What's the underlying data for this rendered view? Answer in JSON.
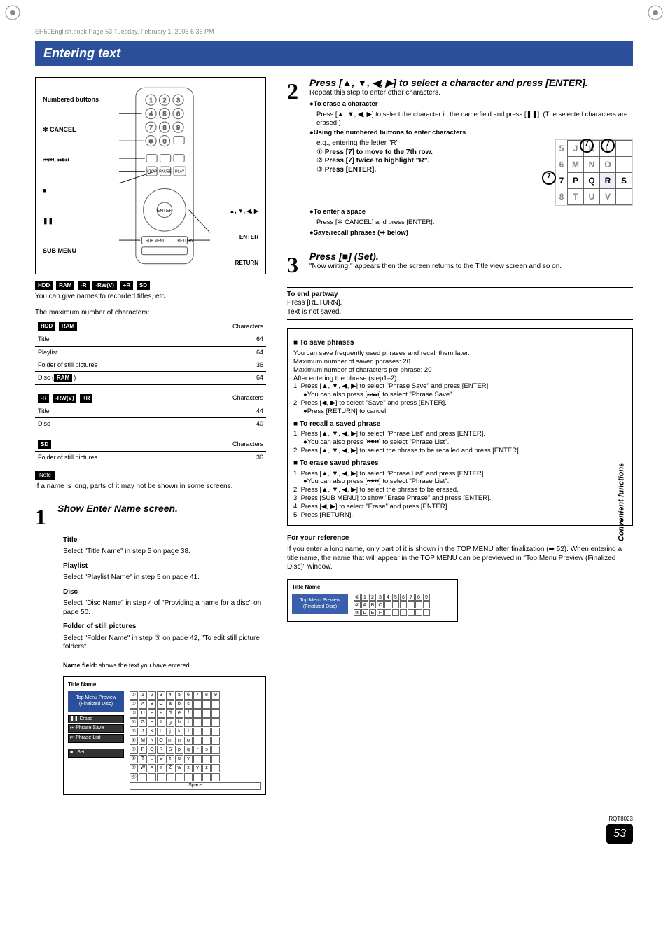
{
  "book_meta": "EH50English.book  Page 53  Tuesday, February 1, 2005  6:36 PM",
  "title": "Entering text",
  "remote": {
    "labels_left": [
      "Numbered buttons",
      "✻ CANCEL",
      "⏮⏮, ⏭⏭",
      "■",
      "❚❚",
      "SUB MENU"
    ],
    "labels_right": [
      "▲, ▼, ◀, ▶",
      "ENTER",
      "RETURN"
    ]
  },
  "formats1": [
    "HDD",
    "RAM",
    "-R",
    "-RW(V)",
    "+R",
    "SD"
  ],
  "intro1": "You can give names to recorded titles, etc.",
  "max_chars_head": "The maximum number of characters:",
  "table1_header_badges": [
    "HDD",
    "RAM"
  ],
  "table1_header_right": "Characters",
  "table1": [
    {
      "l": "Title",
      "r": "64"
    },
    {
      "l": "Playlist",
      "r": "64"
    },
    {
      "l": "Folder of still pictures",
      "r": "36"
    },
    {
      "l": "Disc (RAM)",
      "r": "64"
    }
  ],
  "table2_header_badges": [
    "-R",
    "-RW(V)",
    "+R"
  ],
  "table2_header_right": "Characters",
  "table2": [
    {
      "l": "Title",
      "r": "44"
    },
    {
      "l": "Disc",
      "r": "40"
    }
  ],
  "table3_header_badges": [
    "SD"
  ],
  "table3_header_right": "Characters",
  "table3": [
    {
      "l": "Folder of still pictures",
      "r": "36"
    }
  ],
  "note_label": "Note",
  "note_text": "If a name is long, parts of it may not be shown in some screens.",
  "step1_head": "Show Enter Name screen.",
  "step1_title_h": "Title",
  "step1_title_t": "Select \"Title Name\" in step 5 on page 38.",
  "step1_pl_h": "Playlist",
  "step1_pl_t": "Select \"Playlist Name\" in step 5 on page 41.",
  "step1_disc_h": "Disc",
  "step1_disc_t": "Select \"Disc Name\" in step 4 of \"Providing a name for a disc\" on page 50.",
  "step1_fold_h": "Folder of still pictures",
  "step1_fold_t": "Select \"Folder Name\" in step ③ on page 42, \"To edit still picture folders\".",
  "name_field_label": "Name field:",
  "name_field_text": "shows the text you have entered",
  "tn_title": "Title Name",
  "tn_preview_l1": "Top Menu Preview",
  "tn_preview_l2": "(Finalized Disc)",
  "tn_btn_erase": "Erase",
  "tn_btn_ps": "Phrase Save",
  "tn_btn_pl": "Phrase List",
  "tn_btn_set": "Set",
  "tn_space": "Space",
  "step2_head": "Press [▲, ▼, ◀, ▶] to select a character and press [ENTER].",
  "step2_sub": "Repeat this step to enter other characters.",
  "erase_h": "To erase a character",
  "erase_t": "Press [▲, ▼, ◀, ▶] to select the character in the name field and press [❚❚]. (The selected characters are erased.)",
  "numbtn_h": "Using the numbered buttons to enter characters",
  "numbtn_eg": "e.g., entering the letter \"R\"",
  "numbtn_1": "Press [7] to move to the 7th row.",
  "numbtn_2": "Press [7] twice to highlight \"R\".",
  "numbtn_3": "Press [ENTER].",
  "space_h": "To enter a space",
  "space_t": "Press [✻ CANCEL] and press [ENTER].",
  "saverecall": "Save/recall phrases (➡ below)",
  "step3_head": "Press [■] (Set).",
  "step3_sub": "\"Now writing.\" appears then the screen returns to the Title view screen and so on.",
  "end_h": "To end partway",
  "end_1": "Press [RETURN].",
  "end_2": "Text is not saved.",
  "save_h1": "■ To save phrases",
  "save_1": "You can save frequently used phrases and recall them later.",
  "save_2": "Maximum number of saved phrases: 20",
  "save_3": "Maximum number of characters per phrase: 20",
  "save_4": "After entering the phrase (step1–2)",
  "save_5": "Press [▲, ▼, ◀, ▶] to select \"Phrase Save\" and press [ENTER].",
  "save_5b": "You can also press [⏭⏭] to select \"Phrase Save\".",
  "save_6": "Press [◀, ▶] to select \"Save\" and press [ENTER].",
  "save_6b": "Press [RETURN] to cancel.",
  "save_h2": "■ To recall a saved phrase",
  "save_7": "Press [▲, ▼, ◀, ▶] to select \"Phrase List\" and press [ENTER].",
  "save_7b": "You can also press [⏮⏮] to select \"Phrase List\".",
  "save_8": "Press [▲, ▼, ◀, ▶] to select the phrase to be recalled and press [ENTER].",
  "save_h3": "■ To erase saved phrases",
  "save_9": "Press [▲, ▼, ◀, ▶] to select \"Phrase List\" and press [ENTER].",
  "save_9b": "You can also press [⏮⏮] to select \"Phrase List\".",
  "save_10": "Press [▲, ▼, ◀, ▶] to select the phrase to be erased.",
  "save_11": "Press [SUB MENU] to show \"Erase Phrase\" and press [ENTER].",
  "save_12": "Press [◀, ▶] to select \"Erase\" and press [ENTER].",
  "save_13": "Press [RETURN].",
  "ref_h": "For your reference",
  "ref_t": "If you enter a long name, only part of it is shown in the TOP MENU after finalization (➡ 52). When entering a title name, the name that will appear in the TOP MENU can be previewed in \"Top Menu Preview (Finalized Disc)\" window.",
  "keygrid": [
    [
      "5",
      "J",
      "K",
      "L"
    ],
    [
      "6",
      "M",
      "N",
      "O"
    ],
    [
      "7",
      "P",
      "Q",
      "R"
    ],
    [
      "8",
      "T",
      "U",
      "V"
    ]
  ],
  "side_group": "Convenient functions",
  "rqt": "RQT8023",
  "page_num": "53"
}
